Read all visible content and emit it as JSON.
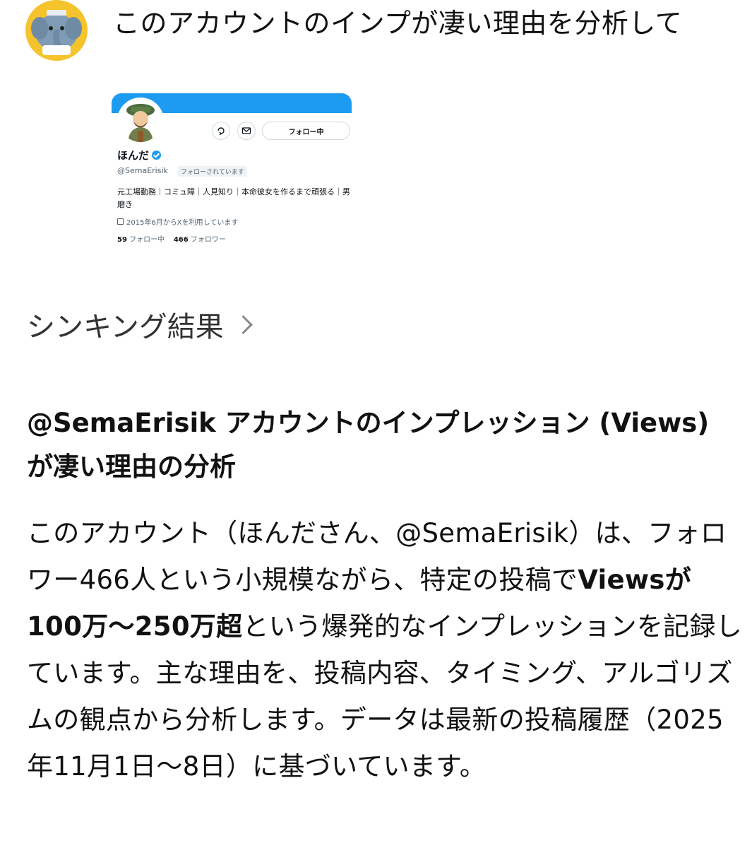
{
  "prompt": {
    "text": "このアカウントのインプが凄い理由を分析して"
  },
  "profile_card": {
    "follow_button": "フォロー中",
    "name": "ほんだ",
    "handle": "@SemaErisik",
    "follows_you": "フォローされています",
    "bio": "元工場勤務｜コミュ障｜人見知り｜本命彼女を作るまで頑張る｜男磨き",
    "joined": "2015年6月からXを利用しています",
    "following_count": "59",
    "following_label": "フォロー中",
    "followers_count": "466",
    "followers_label": "フォロワー",
    "banner_color": "#1d9bf0"
  },
  "thinking": {
    "label": "シンキング結果"
  },
  "answer": {
    "heading": "@SemaErisik アカウントのインプレッション (Views) が凄い理由の分析",
    "body_part1": "このアカウント（ほんださん、@SemaErisik）は、フォロワー466人という小規模ながら、特定の投稿で",
    "body_bold": "Viewsが100万〜250万超",
    "body_part2": "という爆発的なインプレッションを記録しています。主な理由を、投稿内容、タイミング、アルゴリズムの観点から分析します。データは最新の投稿履歴（2025年11月1日〜8日）に基づいています。"
  }
}
